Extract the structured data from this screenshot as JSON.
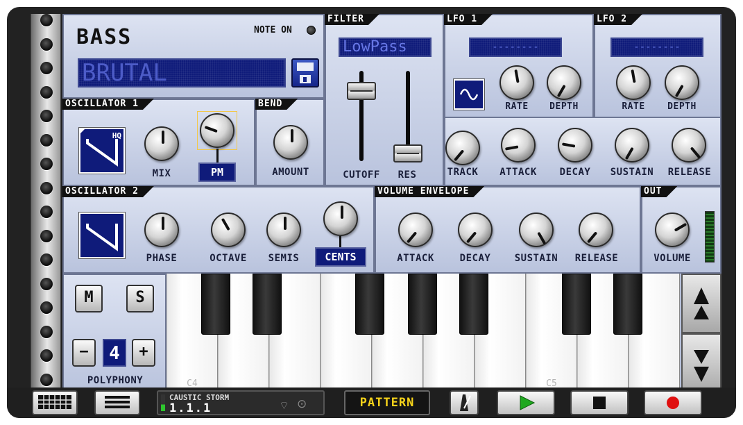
{
  "instrument": {
    "title": "BASS",
    "note_on_label": "NOTE ON",
    "preset_name": "BRUTAL"
  },
  "filter": {
    "tab": "FILTER",
    "type": "LowPass",
    "cutoff_label": "CUTOFF",
    "res_label": "RES",
    "track_label": "TRACK",
    "attack_label": "ATTACK",
    "decay_label": "DECAY",
    "sustain_label": "SUSTAIN",
    "release_label": "RELEASE"
  },
  "lfo1": {
    "tab": "LFO 1",
    "display": "--------",
    "rate_label": "RATE",
    "depth_label": "DEPTH"
  },
  "lfo2": {
    "tab": "LFO 2",
    "display": "--------",
    "rate_label": "RATE",
    "depth_label": "DEPTH"
  },
  "osc1": {
    "tab": "OSCILLATOR 1",
    "hq_label": "HQ",
    "mix_label": "MIX",
    "pm_label": "PM"
  },
  "bend": {
    "tab": "BEND",
    "amount_label": "AMOUNT"
  },
  "osc2": {
    "tab": "OSCILLATOR 2",
    "phase_label": "PHASE",
    "octave_label": "OCTAVE",
    "semis_label": "SEMIS",
    "cents_label": "CENTS"
  },
  "volume_envelope": {
    "tab": "VOLUME ENVELOPE",
    "attack_label": "ATTACK",
    "decay_label": "DECAY",
    "sustain_label": "SUSTAIN",
    "release_label": "RELEASE"
  },
  "out": {
    "tab": "OUT",
    "volume_label": "VOLUME"
  },
  "voice": {
    "mute_label": "M",
    "solo_label": "S",
    "minus_label": "−",
    "plus_label": "+",
    "polyphony_value": "4",
    "polyphony_label": "POLYPHONY"
  },
  "keyboard": {
    "c4_label": "C4",
    "c5_label": "C5"
  },
  "transport": {
    "song_name": "CAUSTIC STORM",
    "position": "1.1.1",
    "pattern_label": "PATTERN"
  },
  "colors": {
    "panel": "#b9c3dd",
    "lcd": "#0f1b7a",
    "lcd_text": "#6777e6",
    "pattern_text": "#f5d21a",
    "play": "#1fa81f",
    "record": "#e01010"
  }
}
